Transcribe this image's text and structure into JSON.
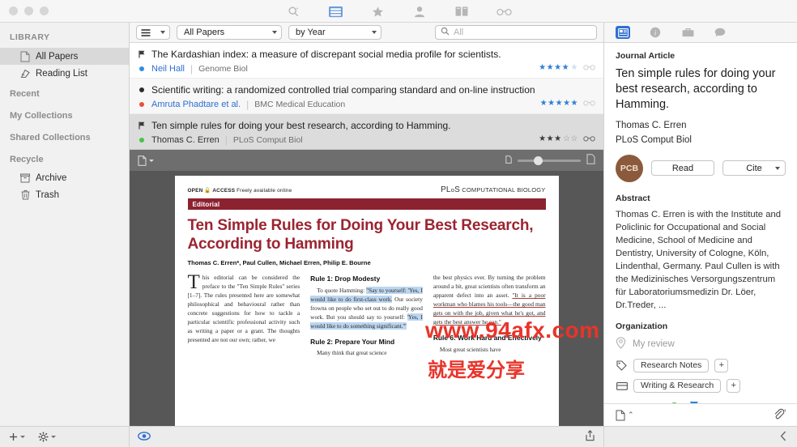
{
  "titlebar": {
    "icons": [
      {
        "name": "search-plus-icon",
        "label": "Search"
      },
      {
        "name": "library-icon",
        "label": "Library",
        "active": true
      },
      {
        "name": "star-icon",
        "label": "Favorites"
      },
      {
        "name": "person-icon",
        "label": "Authors"
      },
      {
        "name": "book-icon",
        "label": "Journals"
      },
      {
        "name": "glasses-icon",
        "label": "Reading"
      }
    ]
  },
  "sidebar": {
    "header": "LIBRARY",
    "items": [
      {
        "label": "All Papers",
        "icon": "document-icon",
        "selected": true
      },
      {
        "label": "Reading List",
        "icon": "reading-list-icon",
        "selected": false
      }
    ],
    "sections": [
      {
        "label": "Recent",
        "items": []
      },
      {
        "label": "My Collections",
        "items": []
      },
      {
        "label": "Shared Collections",
        "items": []
      },
      {
        "label": "Recycle",
        "items": [
          {
            "label": "Archive",
            "icon": "archive-icon"
          },
          {
            "label": "Trash",
            "icon": "trash-icon"
          }
        ]
      }
    ],
    "footer": {
      "add_label": "+",
      "settings_label": "gear"
    }
  },
  "filterbar": {
    "view_menu_label": "list-view",
    "collection_filter": "All Papers",
    "sort_filter": "by Year",
    "search_placeholder": "All",
    "search_value": ""
  },
  "papers": [
    {
      "title": "The Kardashian index: a measure of discrepant social media profile for scientists.",
      "author": "Neil Hall",
      "journal": "Genome Biol",
      "flagged": true,
      "dot_color": "#2f8fe0",
      "rating": 4,
      "rating_max": 5,
      "rating_color": "#2f7fd8",
      "selected": false
    },
    {
      "title": "Scientific writing: a randomized controlled trial comparing standard and on-line instruction",
      "author": "Amruta Phadtare et al.",
      "journal": "BMC Medical Education",
      "flagged": false,
      "dot_color": "#e8503a",
      "rating": 5,
      "rating_max": 5,
      "rating_color": "#2f7fd8",
      "selected": false
    },
    {
      "title": "Ten simple rules for doing your best research, according to Hamming.",
      "author": "Thomas C. Erren",
      "journal": "PLoS Comput Biol",
      "flagged": true,
      "dot_color": "#49c24a",
      "rating": 3,
      "rating_max": 5,
      "rating_color": "#3b3b3b",
      "selected": true
    }
  ],
  "pdf_toolbar": {
    "page_mode_label": "single-page",
    "zoom_percent": 26
  },
  "pdf_page": {
    "open_access": "OPEN",
    "access_word": "ACCESS",
    "free_text": "Freely available online",
    "publisher_prefix": "PL",
    "publisher_o": "o",
    "publisher_s": "S",
    "publisher_suffix": "COMPUTATIONAL BIOLOGY",
    "section_label": "Editorial",
    "title": "Ten Simple Rules for Doing Your Best Research, According to Hamming",
    "authors": "Thomas C. Erren*, Paul Cullen, Michael Erren, Philip E. Bourne",
    "col1_dropcap": "T",
    "col1_text": "his editorial can be considered the preface to the \"Ten Simple Rules\" series [1–7]. The rules presented here are somewhat philosophical and behavioural rather than concrete suggestions for how to tackle a particular scientific professional activity such as writing a paper or a grant. The thoughts presented are not our own; rather, we",
    "col2_rule1_heading": "Rule 1: Drop Modesty",
    "col2_rule1_lead": "To quote Hamming: ",
    "col2_rule1_hl1": "\"Say to yourself: 'Yes, I would like to do first-class work.",
    "col2_rule1_mid": "Our society frowns on people who set out to do really good work. But you should say to yourself: ",
    "col2_rule1_hl2": "'Yes, I would like to do something significant.'\"",
    "col2_rule2_heading": "Rule 2: Prepare Your Mind",
    "col2_rule2_text": "Many think that great science",
    "col3_text": "the best physics ever. By turning the problem around a bit, great scientists often transform an apparent defect into an asset. ",
    "col3_quote": "\"It is a poor workman who blames his tools—the good man gets on with the job, given what he's got, and gets the best answer he can.\"",
    "col3_rule6_heading": "Rule 6: Work Hard and Effectively",
    "col3_rule6_text": "Most great scientists have"
  },
  "center_footer": {
    "preview_toggle_label": "preview-eye",
    "share_label": "share"
  },
  "right_panel": {
    "tabs": [
      {
        "name": "info-panel-icon",
        "label": "Info",
        "active": true
      },
      {
        "name": "details-icon",
        "label": "Details",
        "active": false
      },
      {
        "name": "briefcase-icon",
        "label": "Supplements",
        "active": false
      },
      {
        "name": "comment-icon",
        "label": "Notes",
        "active": false
      }
    ],
    "kicker": "Journal Article",
    "title": "Ten simple rules for doing your best research, according to Hamming.",
    "author": "Thomas C. Erren",
    "journal": "PLoS Comput Biol",
    "avatar_initials": "PCB",
    "avatar_color": "#8b5a3c",
    "read_label": "Read",
    "cite_label": "Cite",
    "abstract_heading": "Abstract",
    "abstract": "Thomas C. Erren is with the Institute and Policlinic for Occupational and Social Medicine, School of Medicine and Dentistry, University of Cologne, Köln, Lindenthal, Germany. Paul Cullen is with the Medizinisches Versorgungszentrum für Laboratoriumsmedizin Dr. Löer, Dr.Treder, ...",
    "organization_heading": "Organization",
    "my_review_label": "My review",
    "keyword_chip": "Research Notes",
    "keyword_add": "+",
    "collection_chip": "Writing & Research",
    "collection_add": "+",
    "rating": 3,
    "rating_max": 5,
    "status_dot_color": "#3cc13b",
    "flag_color": "#2f7fd8",
    "footer_doc_label": "document",
    "footer_attach_label": "attach"
  },
  "watermark": {
    "line1": "www.94afx.com",
    "line2": "就是爱分享"
  }
}
